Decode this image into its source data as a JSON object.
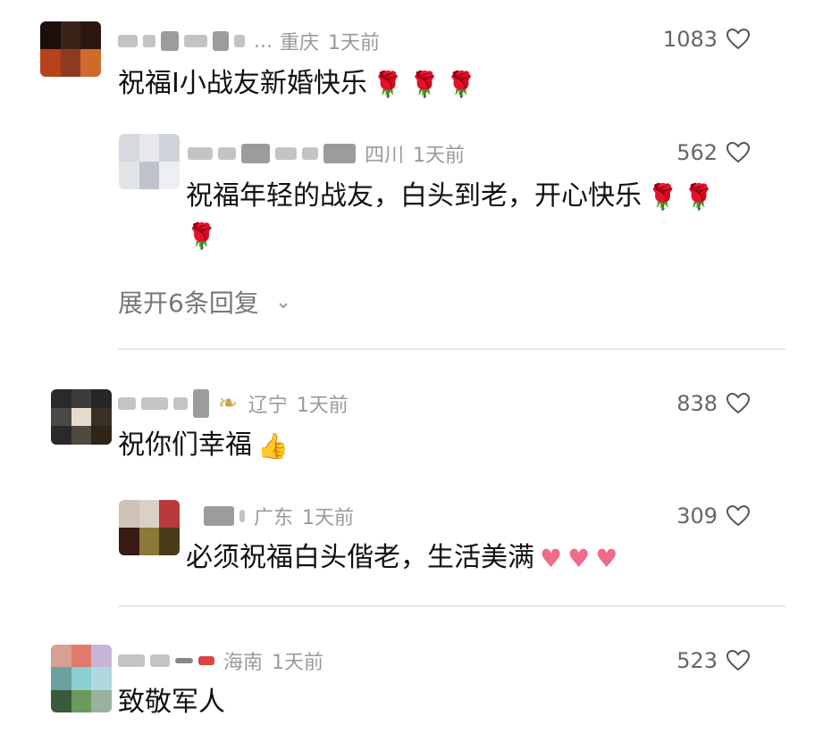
{
  "comments": [
    {
      "location": "重庆",
      "time": "1天前",
      "likes": "1083",
      "text": "祝福I小战友新婚快乐",
      "name_prefix": "..."
    },
    {
      "location": "四川",
      "time": "1天前",
      "likes": "562",
      "text": "祝福年轻的战友，白头到老，开心快乐"
    },
    {
      "location": "辽宁",
      "time": "1天前",
      "likes": "838",
      "text": "祝你们幸福"
    },
    {
      "location": "广东",
      "time": "1天前",
      "likes": "309",
      "text": "必须祝福白头偕老，生活美满"
    },
    {
      "location": "海南",
      "time": "1天前",
      "likes": "523",
      "text": "致敬军人"
    }
  ],
  "expand_replies": "展开6条回复",
  "icons": {
    "like": "heart-outline-icon",
    "expand": "chevron-down-icon",
    "rose": "rose-emoji",
    "thumbs": "thumbs-up-emoji",
    "pink_heart": "pink-heart-emoji",
    "badge": "laurel-badge-icon"
  },
  "colors": {
    "meta": "#9a9a9a",
    "text": "#111111",
    "divider": "#e8e8e8"
  }
}
